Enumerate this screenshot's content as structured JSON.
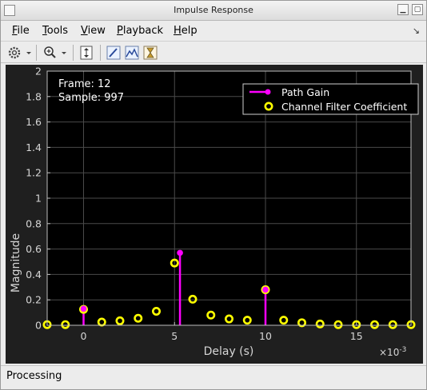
{
  "window": {
    "title": "Impulse Response"
  },
  "menu": [
    {
      "label": "File",
      "key": "F",
      "rest": "ile"
    },
    {
      "label": "Tools",
      "key": "T",
      "rest": "ools"
    },
    {
      "label": "View",
      "key": "V",
      "rest": "iew"
    },
    {
      "label": "Playback",
      "key": "P",
      "rest": "layback"
    },
    {
      "label": "Help",
      "key": "H",
      "rest": "elp"
    }
  ],
  "toolbar": {
    "icons": [
      "gear-icon",
      "zoom-in-icon",
      "autoscale-icon",
      "edit-plot-icon",
      "show-legend-icon",
      "sample-time-icon"
    ]
  },
  "plot": {
    "annotation": {
      "frame_text": "Frame: 12",
      "sample_text": "Sample: 997"
    },
    "legend": {
      "path_gain": "Path Gain",
      "filter_coeff": "Channel Filter Coefficient"
    },
    "colors": {
      "path_gain": "#ff00ff",
      "filter_coeff": "#ffff00",
      "axes_bg": "#000000",
      "grid": "#4a4a4a",
      "text": "#ffffff"
    }
  },
  "chart_data": {
    "type": "scatter",
    "title": "",
    "xlabel": "Delay (s)",
    "ylabel": "Magnitude",
    "xlim": [
      -0.002,
      0.018
    ],
    "ylim": [
      0,
      2
    ],
    "x_exponent_label": "×10",
    "x_exponent_power": "-3",
    "xticks": [
      0,
      0.005,
      0.01,
      0.015
    ],
    "xtick_labels": [
      "0",
      "5",
      "10",
      "15"
    ],
    "yticks": [
      0,
      0.2,
      0.4,
      0.6,
      0.8,
      1,
      1.2,
      1.4,
      1.6,
      1.8,
      2
    ],
    "ytick_labels": [
      "0",
      "0.2",
      "0.4",
      "0.6",
      "0.8",
      "1",
      "1.2",
      "1.4",
      "1.6",
      "1.8",
      "2"
    ],
    "grid": true,
    "legend_position": "top-right",
    "series": [
      {
        "name": "Path Gain",
        "style": "stem",
        "x": [
          0.0,
          0.0053,
          0.01
        ],
        "y": [
          0.13,
          0.57,
          0.28
        ]
      },
      {
        "name": "Channel Filter Coefficient",
        "style": "markers",
        "x": [
          -0.002,
          -0.001,
          0.0,
          0.001,
          0.002,
          0.003,
          0.004,
          0.005,
          0.006,
          0.007,
          0.008,
          0.009,
          0.01,
          0.011,
          0.012,
          0.013,
          0.014,
          0.015,
          0.016,
          0.017,
          0.018
        ],
        "y": [
          0.005,
          0.005,
          0.125,
          0.025,
          0.035,
          0.055,
          0.11,
          0.49,
          0.205,
          0.08,
          0.05,
          0.04,
          0.28,
          0.04,
          0.02,
          0.01,
          0.005,
          0.005,
          0.005,
          0.005,
          0.005
        ]
      }
    ]
  },
  "status": {
    "text": "Processing"
  }
}
